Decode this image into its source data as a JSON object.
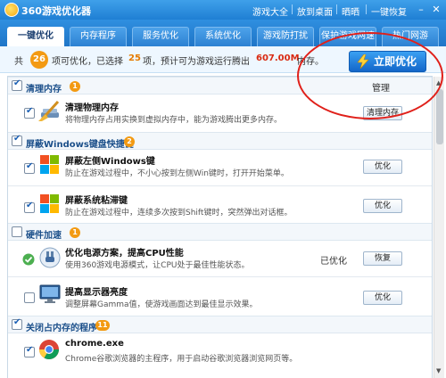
{
  "app": {
    "title": "360游戏优化器",
    "links": [
      "游戏大全",
      "放到桌面",
      "晒晒",
      "一键恢复"
    ]
  },
  "tabs": [
    {
      "label": "一键优化",
      "active": true
    },
    {
      "label": "内存程序",
      "active": false
    },
    {
      "label": "服务优化",
      "active": false
    },
    {
      "label": "系统优化",
      "active": false
    },
    {
      "label": "游戏防打扰",
      "active": false
    },
    {
      "label": "保护游戏网速",
      "active": false
    },
    {
      "label": "热门网游",
      "active": false
    }
  ],
  "summary": {
    "prefix": "共",
    "total": "26",
    "mid1": "项可优化，已选择",
    "selected": "25",
    "mid2": "项，预计可为游戏运行腾出",
    "amount": "607.00M",
    "suffix": "内存。",
    "button": "立即优化"
  },
  "manage_label": "管理",
  "sections": [
    {
      "title": "清理内存",
      "badge": "1",
      "items": [
        {
          "title": "清理物理内存",
          "desc": "将物理内存占用实换到虚拟内存中，能为游戏腾出更多内存。",
          "action": "清理内存",
          "status": ""
        }
      ]
    },
    {
      "title": "屏蔽Windows键盘快捷键",
      "badge": "2",
      "items": [
        {
          "title": "屏蔽左侧Windows键",
          "desc": "防止在游戏过程中，不小心按到左侧Win键时，打开开始菜单。",
          "action": "优化",
          "status": ""
        },
        {
          "title": "屏蔽系统粘滞键",
          "desc": "防止在游戏过程中，连续多次按到Shift键时，突然弹出对话框。",
          "action": "优化",
          "status": ""
        }
      ]
    },
    {
      "title": "硬件加速",
      "badge": "1",
      "items": [
        {
          "title": "优化电源方案，提高CPU性能",
          "desc": "使用360游戏电源模式，让CPU处于最佳性能状态。",
          "action": "恢复",
          "status": "已优化"
        },
        {
          "title": "提高显示器亮度",
          "desc": "调整屏幕Gamma值，使游戏画面达到最佳显示效果。",
          "action": "优化",
          "status": ""
        }
      ]
    },
    {
      "title": "关闭占内存的程序",
      "badge": "11",
      "items": [
        {
          "title": "chrome.exe",
          "desc": "Chrome谷歌浏览器的主程序，用于启动谷歌浏览器浏览网页等。",
          "action": "",
          "status": ""
        }
      ]
    }
  ],
  "colors": {
    "accent": "#1f7fd4",
    "badge": "#f39a12",
    "annotation": "#e0201a"
  }
}
